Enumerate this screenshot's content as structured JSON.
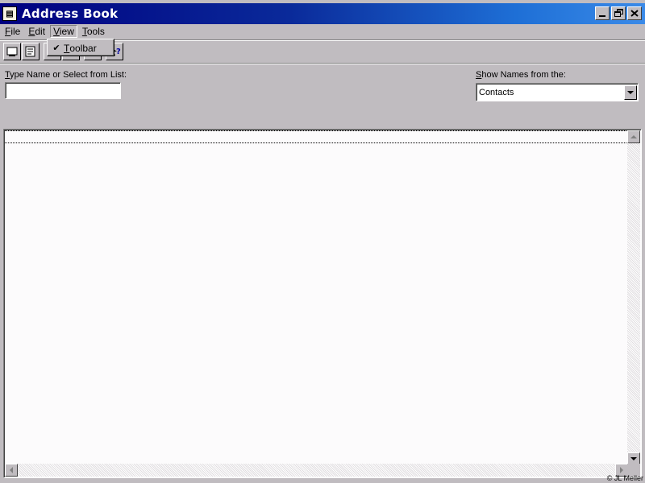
{
  "window": {
    "title": "Address Book",
    "icon": "address-book-icon",
    "controls": [
      "minimize-icon",
      "restore-icon",
      "close-icon"
    ]
  },
  "menu": {
    "file": {
      "pre": "",
      "accel": "F",
      "post": "ile"
    },
    "edit": {
      "pre": "",
      "accel": "E",
      "post": "dit"
    },
    "view": {
      "pre": "",
      "accel": "V",
      "post": "iew"
    },
    "tools": {
      "pre": "",
      "accel": "T",
      "post": "ools"
    }
  },
  "view_menu": {
    "items": [
      {
        "accel": "T",
        "post": "oolbar",
        "checked": true,
        "check_glyph": "✔"
      }
    ]
  },
  "toolbar": {
    "buttons": [
      "new-contact-icon",
      "properties-icon",
      "delete-icon",
      "find-icon",
      "send-mail-icon",
      "help-icon"
    ]
  },
  "search": {
    "label_accel": "T",
    "label_rest": "ype Name or Select from List:",
    "value": ""
  },
  "source": {
    "label_accel": "S",
    "label_rest": "how Names from the:",
    "selected": "Contacts"
  },
  "footer": {
    "copyright": "© JL Meller"
  },
  "colors": {
    "title_start": "#000080",
    "title_end": "#3a8ae8",
    "face": "#c0bcc0",
    "list_bg": "#fcfbfc"
  }
}
